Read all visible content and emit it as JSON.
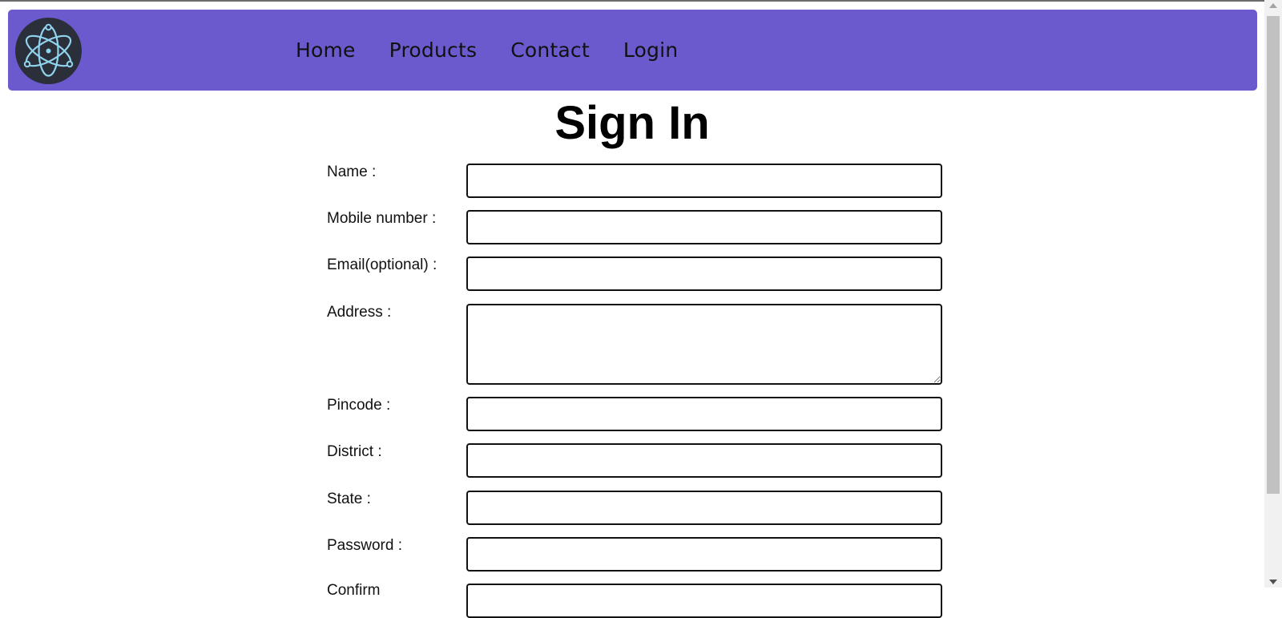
{
  "nav": {
    "logo_icon": "atom-icon",
    "links": [
      "Home",
      "Products",
      "Contact",
      "Login"
    ]
  },
  "page": {
    "title": "Sign In"
  },
  "form": {
    "name_label": "Name :",
    "mobile_label": "Mobile number :",
    "email_label": "Email(optional) :",
    "address_label": "Address :",
    "pincode_label": "Pincode :",
    "district_label": "District :",
    "state_label": "State :",
    "password_label": "Password :",
    "confirm_label": "Confirm",
    "name_value": "",
    "mobile_value": "",
    "email_value": "",
    "address_value": "",
    "pincode_value": "",
    "district_value": "",
    "state_value": "",
    "password_value": "",
    "confirm_value": ""
  },
  "colors": {
    "navbar": "#6a5acd",
    "logo_bg": "#2b2f3a",
    "logo_stroke": "#8fd3ee"
  }
}
